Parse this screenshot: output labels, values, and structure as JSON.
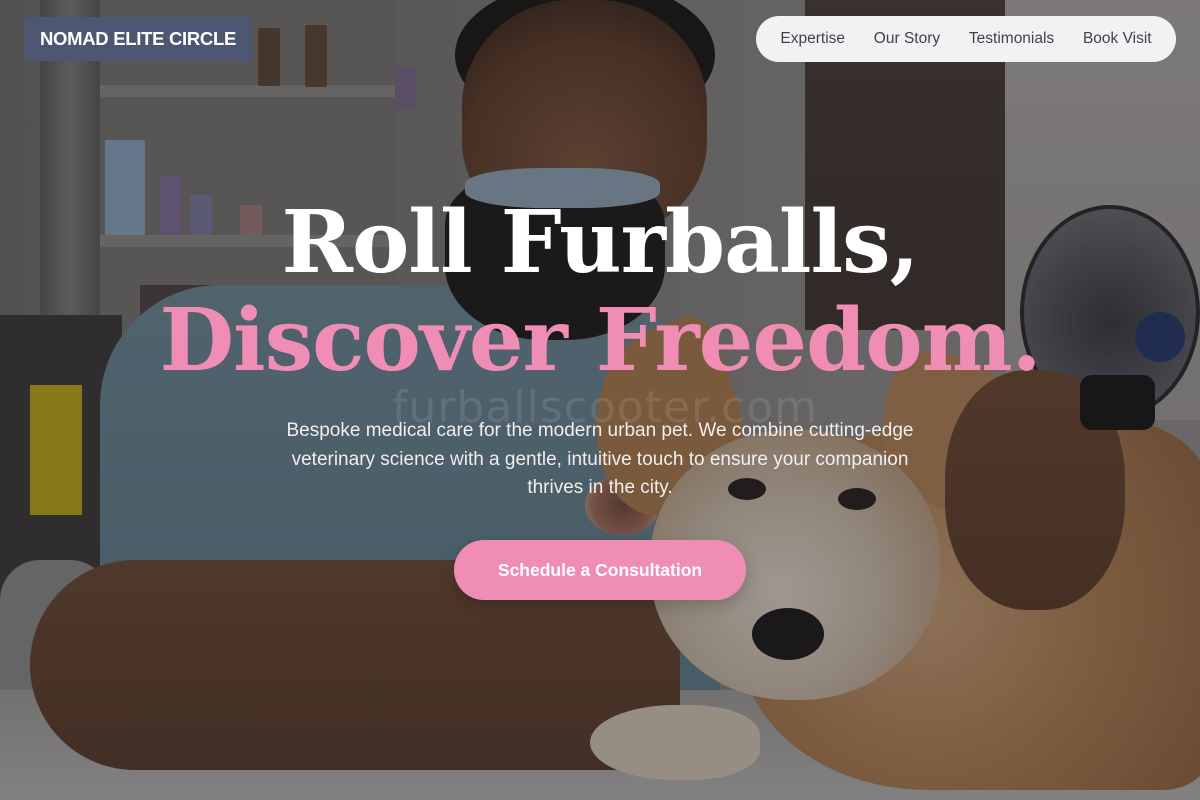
{
  "brand": {
    "name": "NOMAD ELITE CIRCLE",
    "background_color": "#4e5771"
  },
  "nav": {
    "items": [
      {
        "label": "Expertise"
      },
      {
        "label": "Our Story"
      },
      {
        "label": "Testimonials"
      },
      {
        "label": "Book Visit"
      }
    ]
  },
  "hero": {
    "headline_line1": "Roll Furballs,",
    "headline_line2": "Discover Freedom.",
    "headline_line1_color": "#ffffff",
    "headline_line2_color": "#f08db5",
    "description": "Bespoke medical care for the modern urban pet. We combine cutting-edge veterinary science with a gentle, intuitive touch to ensure your companion thrives in the city.",
    "cta_label": "Schedule a Consultation",
    "cta_color": "#f08db5",
    "watermark": "furballscooter.com"
  },
  "background": {
    "icon": "veterinarian-with-corgi-photo"
  }
}
